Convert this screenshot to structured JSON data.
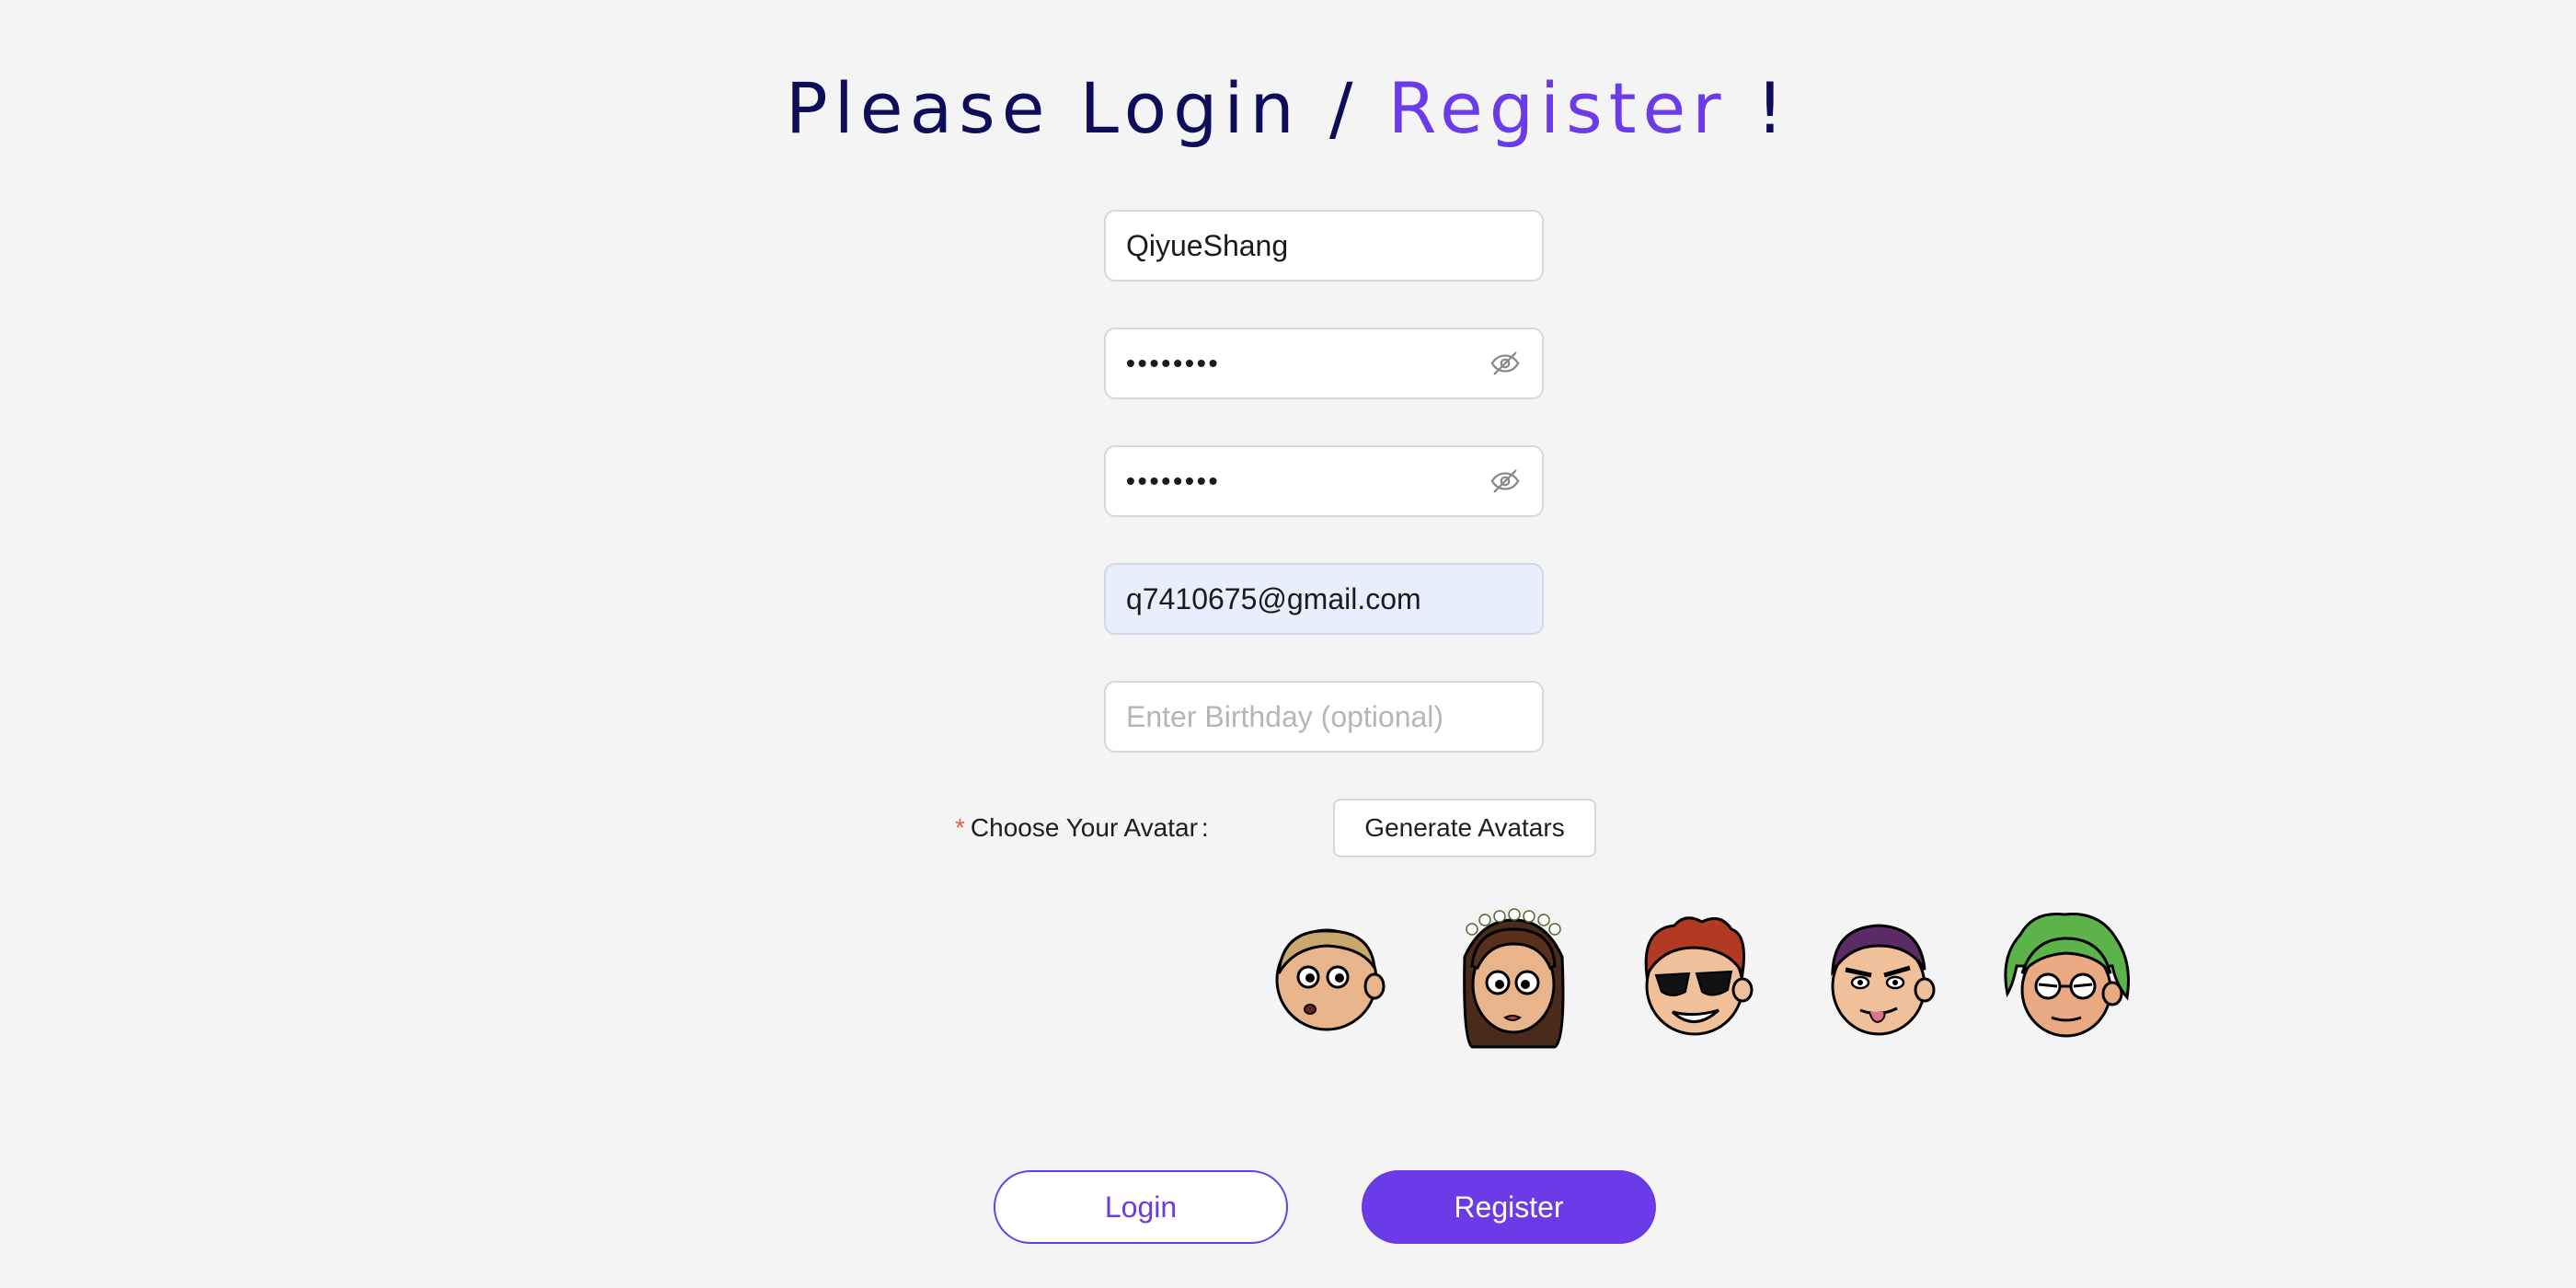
{
  "header": {
    "title_part1": "Please Login / ",
    "title_accent": "Register",
    "title_part2": " !"
  },
  "form": {
    "username": {
      "value": "QiyueShang"
    },
    "password": {
      "value": "••••••••"
    },
    "confirm_password": {
      "value": "••••••••"
    },
    "email": {
      "value": "q7410675@gmail.com"
    },
    "birthday": {
      "placeholder": "Enter Birthday (optional)"
    }
  },
  "avatar_section": {
    "required_mark": "*",
    "label": "Choose Your Avatar",
    "colon": ":",
    "generate_button": "Generate Avatars",
    "avatars": [
      {
        "icon": "bald-boy-avatar-icon"
      },
      {
        "icon": "flower-crown-girl-avatar-icon"
      },
      {
        "icon": "sunglasses-redhead-avatar-icon"
      },
      {
        "icon": "tongue-out-purple-hair-avatar-icon"
      },
      {
        "icon": "green-hair-glasses-avatar-icon"
      }
    ]
  },
  "actions": {
    "login_label": "Login",
    "register_label": "Register"
  },
  "colors": {
    "accent": "#6b3be8",
    "title_dark": "#0f0c5a",
    "background": "#f4f4f4"
  }
}
